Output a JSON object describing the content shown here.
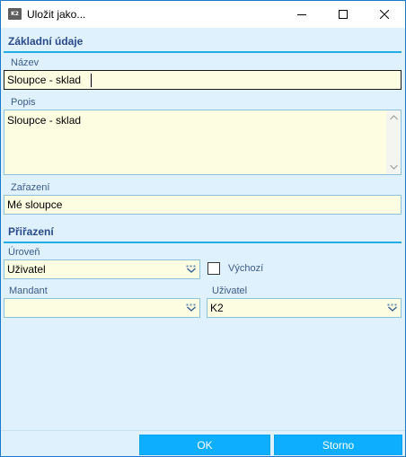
{
  "window": {
    "title": "Uložit jako...",
    "icon_text": "K2",
    "minimize_icon": "minimize-icon",
    "maximize_icon": "maximize-icon",
    "close_icon": "close-icon"
  },
  "basic": {
    "heading": "Základní údaje",
    "name_label": "Název",
    "name_value": "Sloupce - sklad",
    "desc_label": "Popis",
    "desc_value": "Sloupce - sklad",
    "category_label": "Zařazení",
    "category_value": "Mé sloupce"
  },
  "assignment": {
    "heading": "Přiřazení",
    "level_label": "Úroveň",
    "level_value": "Uživatel",
    "default_label": "Výchozí",
    "default_checked": false,
    "mandant_label": "Mandant",
    "mandant_value": "",
    "user_label": "Uživatel",
    "user_value": "K2"
  },
  "footer": {
    "ok_label": "OK",
    "cancel_label": "Storno"
  },
  "colors": {
    "accent": "#23aee3",
    "button": "#0daefe",
    "field_bg": "#fdfde2",
    "panel_bg": "#dff1fd"
  }
}
